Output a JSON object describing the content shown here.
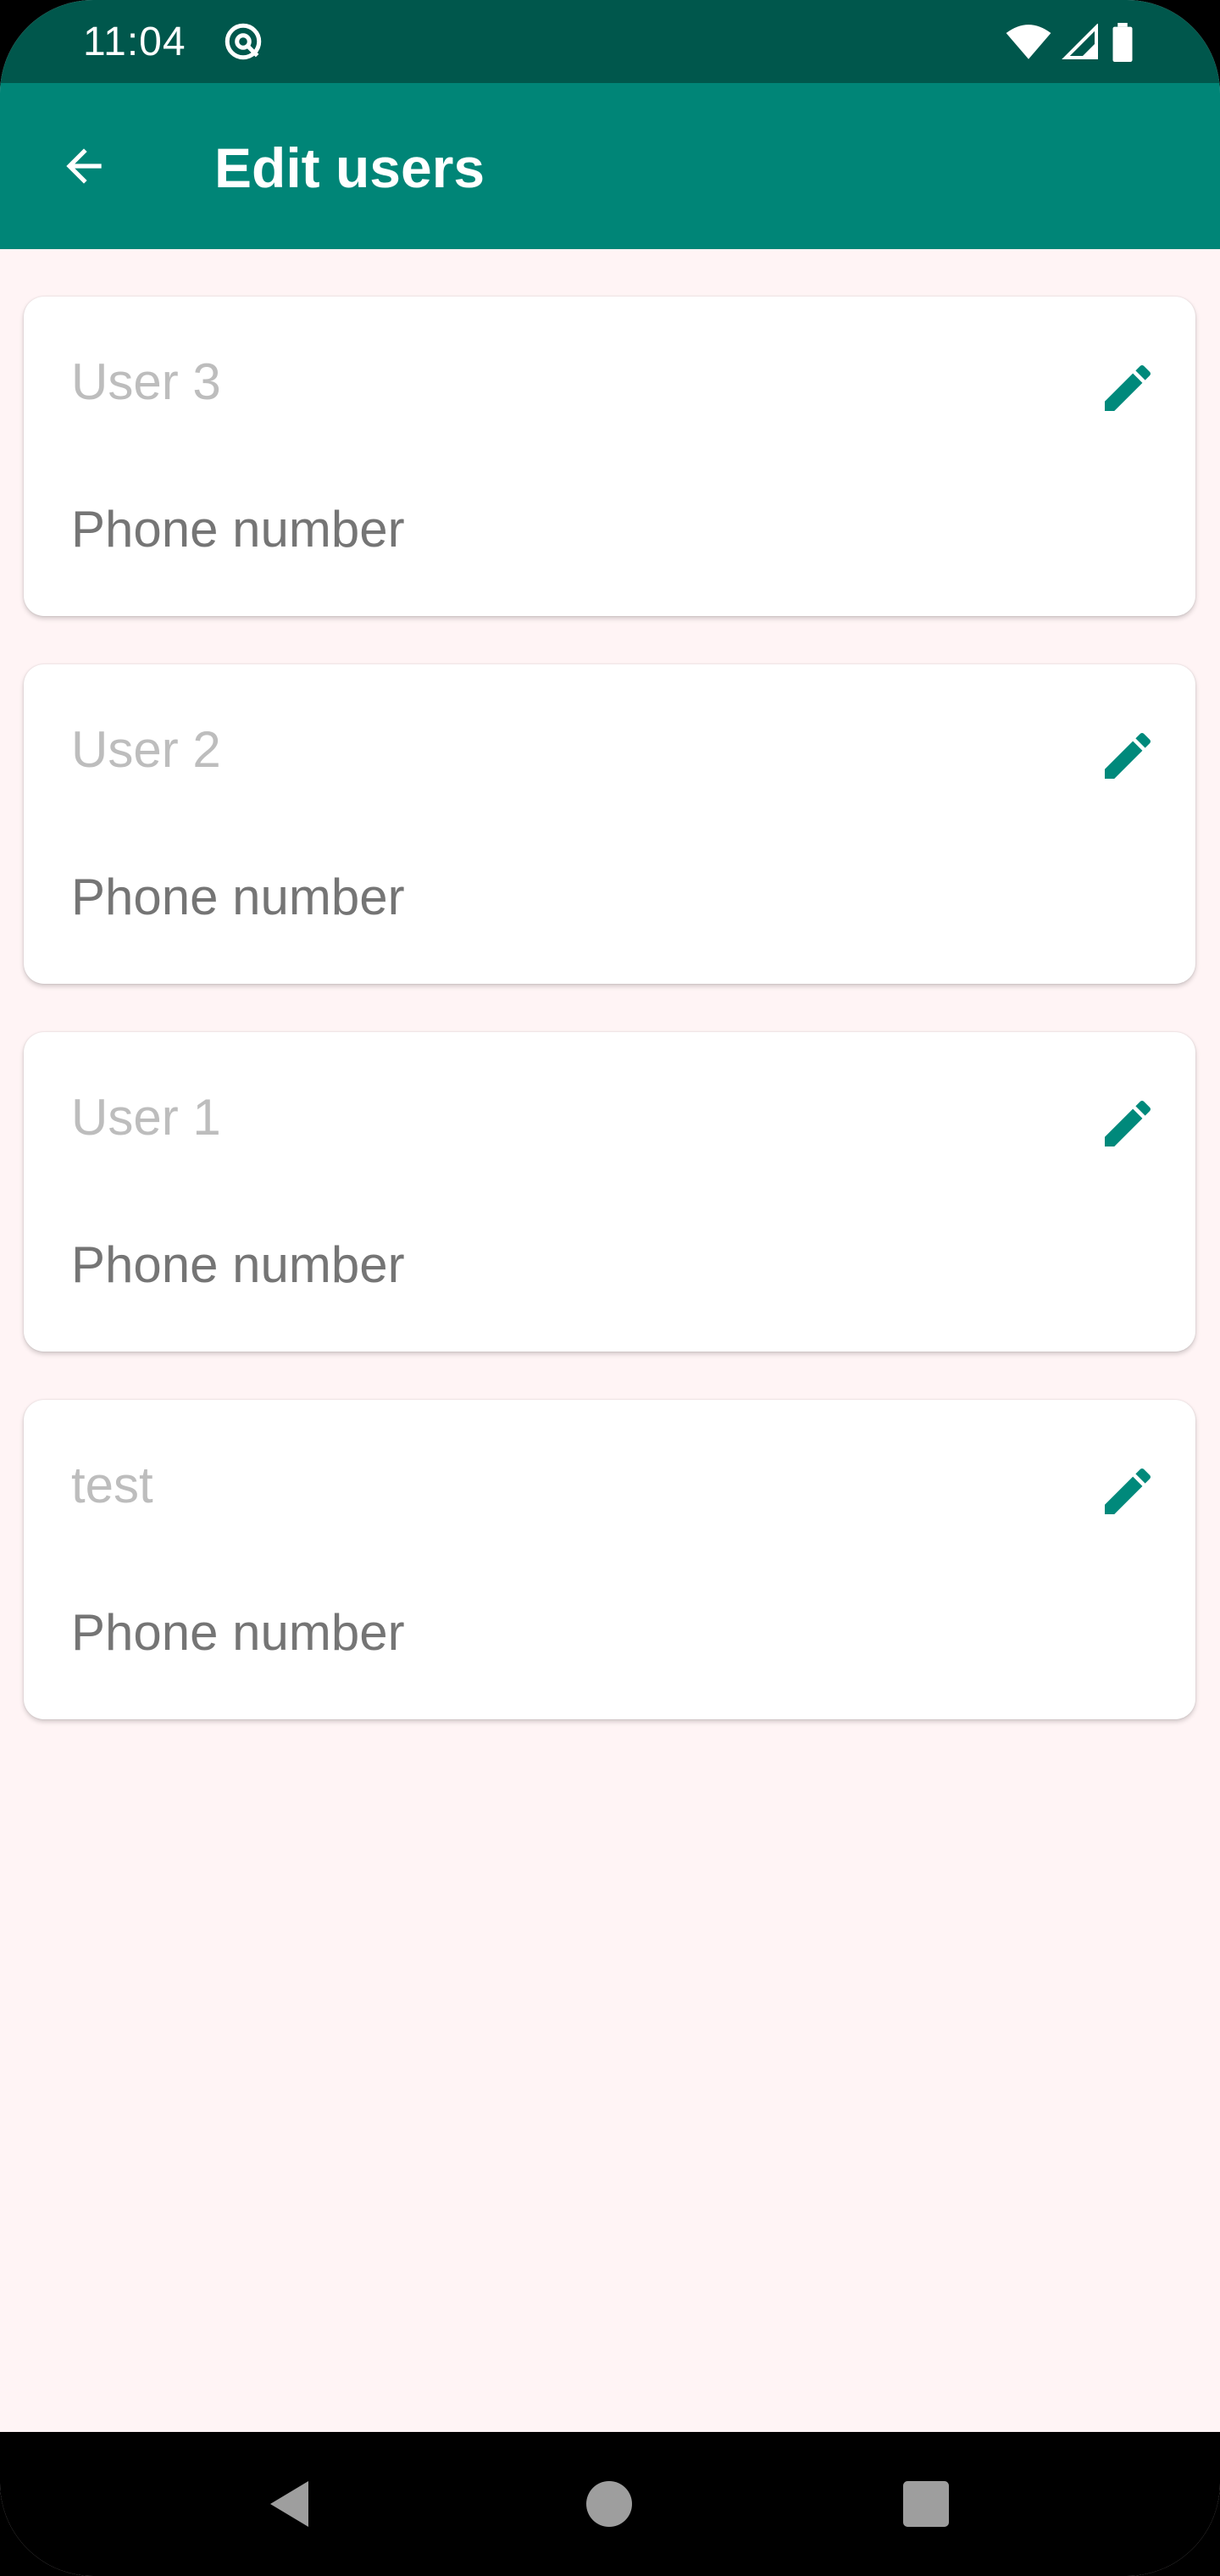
{
  "status_bar": {
    "time": "11:04",
    "icons": [
      "at-sign-icon",
      "wifi-icon",
      "signal-icon",
      "battery-icon"
    ]
  },
  "app_bar": {
    "title": "Edit users",
    "back_icon": "arrow-back-icon"
  },
  "users": [
    {
      "name": "User 3",
      "phone_placeholder": "Phone number"
    },
    {
      "name": "User 2",
      "phone_placeholder": "Phone number"
    },
    {
      "name": "User 1",
      "phone_placeholder": "Phone number"
    },
    {
      "name": "test",
      "phone_placeholder": "Phone number"
    }
  ],
  "nav_bar": {
    "icons": [
      "back-triangle-icon",
      "home-circle-icon",
      "recents-square-icon"
    ]
  },
  "colors": {
    "primary": "#008577",
    "primary_dark": "#00574c",
    "background": "#fff4f5",
    "accent_icon": "#00897b"
  }
}
